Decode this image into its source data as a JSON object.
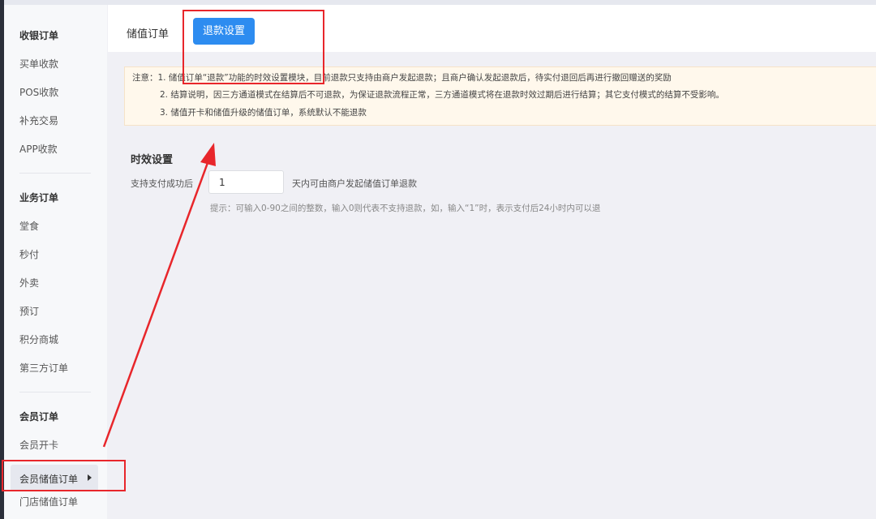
{
  "sidebar": {
    "groups": [
      {
        "title": "收银订单",
        "items": [
          "买单收款",
          "POS收款",
          "补充交易",
          "APP收款"
        ]
      },
      {
        "title": "业务订单",
        "items": [
          "堂食",
          "秒付",
          "外卖",
          "预订",
          "积分商城",
          "第三方订单"
        ]
      },
      {
        "title": "会员订单",
        "items": [
          "会员开卡",
          "会员储值订单",
          "门店储值订单"
        ]
      }
    ],
    "active_item": "会员储值订单"
  },
  "tabs": {
    "items": [
      "储值订单",
      "退款设置"
    ],
    "active": "退款设置"
  },
  "notice": {
    "line1": "注意：1. 储值订单“退款”功能的时效设置模块，目前退款只支持由商户发起退款；且商户确认发起退款后，待实付退回后再进行撤回赠送的奖励",
    "line2": "2. 结算说明，因三方通道模式在结算后不可退款，为保证退款流程正常，三方通道模式将在退款时效过期后进行结算；其它支付模式的结算不受影响。",
    "line3": "3. 储值开卡和储值升级的储值订单，系统默认不能退款"
  },
  "settings": {
    "section_title": "时效设置",
    "field_label": "支持支付成功后",
    "field_value": "1",
    "field_suffix": "天内可由商户发起储值订单退款",
    "hint": "提示：可输入0-90之间的整数，输入0则代表不支持退款，如，输入“1”时，表示支付后24小时内可以退"
  },
  "annotation_color": "#e8262b"
}
